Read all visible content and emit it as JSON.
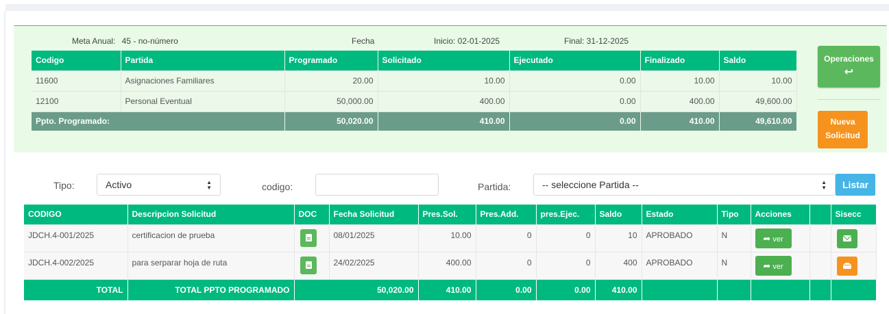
{
  "summary": {
    "meta_label": "Meta Anual:",
    "meta_value": "45 - no-número",
    "fecha_label": "Fecha",
    "inicio": "Inicio: 02-01-2025",
    "final": "Final: 31-12-2025",
    "headers": [
      "Codigo",
      "Partida",
      "Programado",
      "Solicitado",
      "Ejecutado",
      "Finalizado",
      "Saldo"
    ],
    "rows": [
      [
        "11600",
        "Asignaciones Familiares",
        "20.00",
        "10.00",
        "0.00",
        "10.00",
        "10.00"
      ],
      [
        "12100",
        "Personal Eventual",
        "50,000.00",
        "400.00",
        "0.00",
        "400.00",
        "49,600.00"
      ]
    ],
    "total": [
      "Ppto. Programado:",
      "50,020.00",
      "410.00",
      "0.00",
      "410.00",
      "49,610.00"
    ]
  },
  "buttons": {
    "operaciones": "Operaciones",
    "nueva_1": "Nueva",
    "nueva_2": "Solicitud",
    "listar": "Listar",
    "ver": "ver"
  },
  "filters": {
    "tipo_label": "Tipo:",
    "tipo_value": "Activo",
    "codigo_label": "codigo:",
    "codigo_value": "",
    "partida_label": "Partida:",
    "partida_value": "-- seleccione Partida --"
  },
  "main": {
    "headers": [
      "CODIGO",
      "Descripcion Solicitud",
      "DOC",
      "Fecha Solicitud",
      "Pres.Sol.",
      "Pres.Add.",
      "pres.Ejec.",
      "Saldo",
      "Estado",
      "Tipo",
      "Acciones",
      "",
      "Sisecc"
    ],
    "rows": [
      {
        "codigo": "JDCH.4-001/2025",
        "descripcion": "certificacion de prueba",
        "fecha": "08/01/2025",
        "pres_sol": "10.00",
        "pres_add": "0",
        "pres_ejec": "0",
        "saldo": "10",
        "estado": "APROBADO",
        "tipo": "N"
      },
      {
        "codigo": "JDCH.4-002/2025",
        "descripcion": "para serparar hoja de ruta",
        "fecha": "24/02/2025",
        "pres_sol": "400.00",
        "pres_add": "0",
        "pres_ejec": "0",
        "saldo": "400",
        "estado": "APROBADO",
        "tipo": "N"
      }
    ],
    "total": {
      "label": "TOTAL",
      "label2": "TOTAL PPTO PROGRAMADO",
      "programado": "50,020.00",
      "pres_sol": "410.00",
      "pres_add": "0.00",
      "pres_ejec": "0.00",
      "saldo": "410.00"
    }
  },
  "icons": {
    "operaciones": "reply-icon",
    "doc": "document-icon",
    "ver": "share-arrow-icon",
    "sisecc_1": "envelope-icon",
    "sisecc_2": "envelope-open-icon",
    "select": "select-arrows-icon"
  },
  "colors": {
    "accent_green": "#00b97f",
    "button_green": "#5cb85c",
    "orange": "#f6931e",
    "blue": "#45b4e6",
    "total_row": "#6b9c8a",
    "panel_bg": "#e9fbe7"
  }
}
